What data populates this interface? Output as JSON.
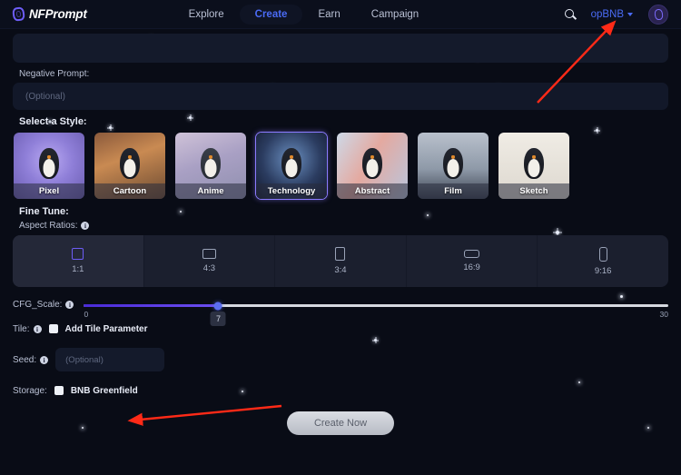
{
  "header": {
    "logo_text": "NFPrompt",
    "nav": [
      {
        "label": "Explore",
        "active": false
      },
      {
        "label": "Create",
        "active": true
      },
      {
        "label": "Earn",
        "active": false
      },
      {
        "label": "Campaign",
        "active": false
      }
    ],
    "chain_label": "opBNB",
    "search_icon": "search-icon",
    "avatar_icon": "avatar-icon"
  },
  "form": {
    "prompt_value": "",
    "negative_prompt_label": "Negative Prompt:",
    "negative_prompt_placeholder": "(Optional)",
    "negative_prompt_value": "",
    "select_style_label": "Select a Style:",
    "styles": [
      {
        "label": "Pixel",
        "selected": false,
        "art": "art-pixel"
      },
      {
        "label": "Cartoon",
        "selected": false,
        "art": "art-cartoon"
      },
      {
        "label": "Anime",
        "selected": false,
        "art": "art-anime"
      },
      {
        "label": "Technology",
        "selected": true,
        "art": "art-technology"
      },
      {
        "label": "Abstract",
        "selected": false,
        "art": "art-abstract"
      },
      {
        "label": "Film",
        "selected": false,
        "art": "art-film"
      },
      {
        "label": "Sketch",
        "selected": false,
        "art": "art-sketch"
      }
    ],
    "fine_tune_label": "Fine Tune:",
    "aspect_ratios_label": "Aspect Ratios:",
    "aspect_ratios": [
      {
        "label": "1:1",
        "selected": true,
        "w": 13,
        "h": 13
      },
      {
        "label": "4:3",
        "selected": false,
        "w": 15,
        "h": 11
      },
      {
        "label": "3:4",
        "selected": false,
        "w": 11,
        "h": 15
      },
      {
        "label": "16:9",
        "selected": false,
        "w": 17,
        "h": 9
      },
      {
        "label": "9:16",
        "selected": false,
        "w": 9,
        "h": 16
      }
    ],
    "cfg_scale_label": "CFG_Scale:",
    "cfg_scale_value": "7",
    "cfg_scale_min": "0",
    "cfg_scale_max": "30",
    "cfg_scale_percent": 23,
    "tile_label": "Tile:",
    "tile_checkbox_label": "Add Tile Parameter",
    "tile_checked": false,
    "seed_label": "Seed:",
    "seed_placeholder": "(Optional)",
    "seed_value": "",
    "storage_label": "Storage:",
    "storage_checkbox_label": "BNB Greenfield",
    "storage_checked": false,
    "create_button_label": "Create Now"
  },
  "annotations": {
    "arrow_color": "#ff2a17",
    "arrow_1_target": "opBNB chain selector",
    "arrow_2_target": "BNB Greenfield checkbox"
  },
  "colors": {
    "background": "#090c16",
    "header_bg": "#0b0f1c",
    "accent_blue": "#4a6bf5",
    "accent_purple": "#6d5df6",
    "panel": "#1b1f2e",
    "input_bg": "#141a2b",
    "text_primary": "#e8ecf7",
    "text_muted": "#b9c0d4"
  }
}
